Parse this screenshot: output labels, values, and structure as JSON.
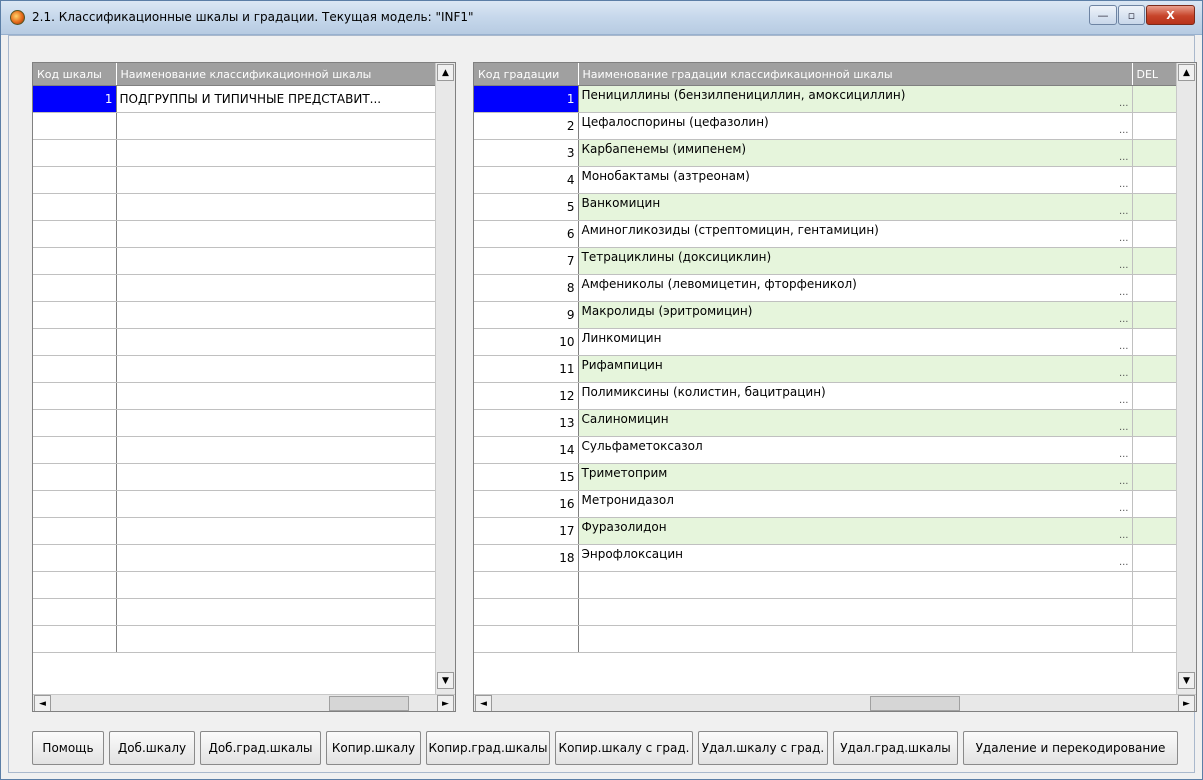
{
  "window": {
    "title": "2.1. Классификационные шкалы и градации. Текущая модель: \"INF1\"",
    "controls": {
      "minimize": "—",
      "maximize": "▫",
      "close": "X"
    }
  },
  "scales_grid": {
    "columns": [
      "Код шкалы",
      "Наименование классификационной шкалы"
    ],
    "rows": [
      {
        "code": "1",
        "name": "ПОДГРУППЫ И ТИПИЧНЫЕ ПРЕДСТАВИТ..."
      }
    ],
    "selected_row": 0
  },
  "gradations_grid": {
    "columns": [
      "Код градации",
      "Наименование градации классификационной шкалы",
      "DEL"
    ],
    "rows": [
      {
        "code": "1",
        "name": "Пенициллины (бензилпенициллин, амоксициллин)"
      },
      {
        "code": "2",
        "name": "Цефалоспорины (цефазолин)"
      },
      {
        "code": "3",
        "name": "Карбапенемы (имипенем)"
      },
      {
        "code": "4",
        "name": "Монобактамы (азтреонам)"
      },
      {
        "code": "5",
        "name": "Ванкомицин"
      },
      {
        "code": "6",
        "name": "Аминогликозиды (стрептомицин, гентамицин)"
      },
      {
        "code": "7",
        "name": "Тетрациклины (доксициклин)"
      },
      {
        "code": "8",
        "name": "Амфениколы (левомицетин, фторфеникол)"
      },
      {
        "code": "9",
        "name": "Макролиды (эритромицин)"
      },
      {
        "code": "10",
        "name": "Линкомицин"
      },
      {
        "code": "11",
        "name": "Рифампицин"
      },
      {
        "code": "12",
        "name": "Полимиксины (колистин, бацитрацин)"
      },
      {
        "code": "13",
        "name": "Салиномицин"
      },
      {
        "code": "14",
        "name": "Сульфаметоксазол"
      },
      {
        "code": "15",
        "name": "Триметоприм"
      },
      {
        "code": "16",
        "name": "Метронидазол"
      },
      {
        "code": "17",
        "name": "Фуразолидон"
      },
      {
        "code": "18",
        "name": "Энрофлоксацин"
      }
    ],
    "ellipsis": "...",
    "selected_row": 0
  },
  "scroll_glyphs": {
    "up": "▲",
    "down": "▼",
    "left": "◄",
    "right": "►"
  },
  "buttons": [
    "Помощь",
    "Доб.шкалу",
    "Доб.град.шкалы",
    "Копир.шкалу",
    "Копир.град.шкалы",
    "Копир.шкалу с град.",
    "Удал.шкалу с град.",
    "Удал.град.шкалы",
    "Удаление и перекодирование"
  ],
  "colors": {
    "selection": "#0000ff",
    "header": "#a0a0a0",
    "alt_row": "#e6f5dc"
  }
}
